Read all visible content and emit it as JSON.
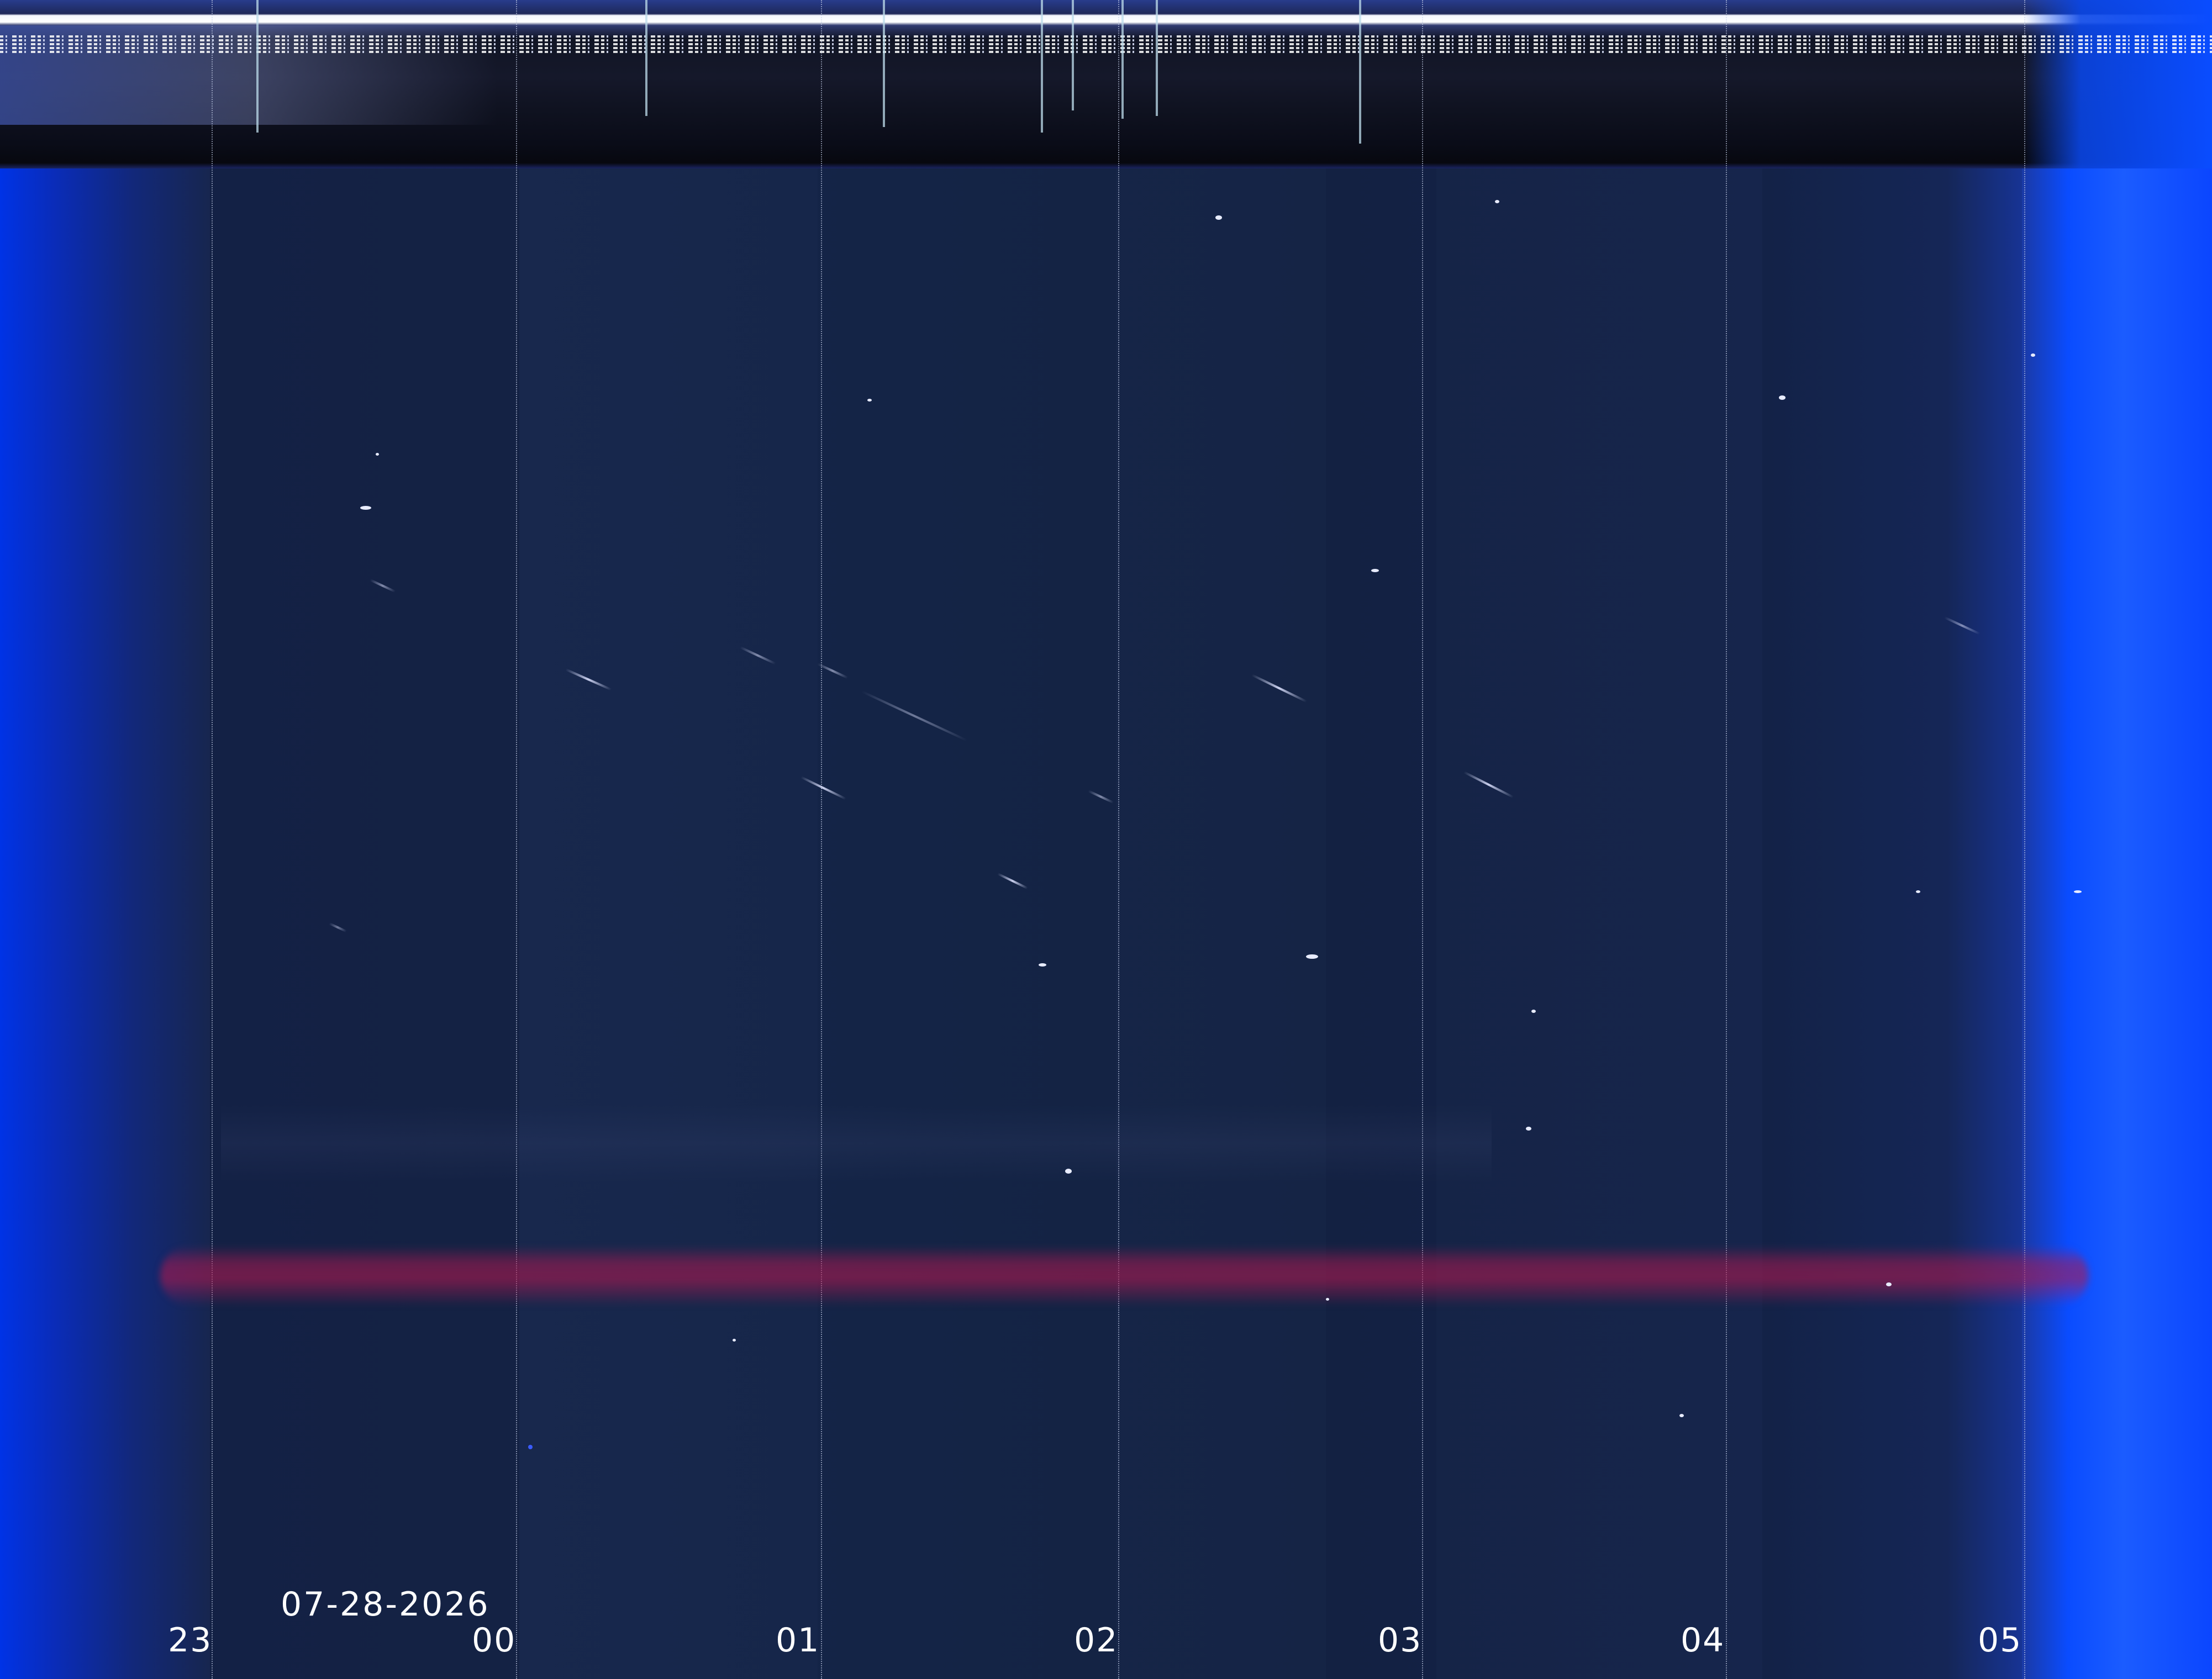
{
  "image": {
    "date_label": "07-28-2026",
    "hour_ticks": [
      "23",
      "00",
      "01",
      "02",
      "03",
      "04",
      "05"
    ]
  }
}
